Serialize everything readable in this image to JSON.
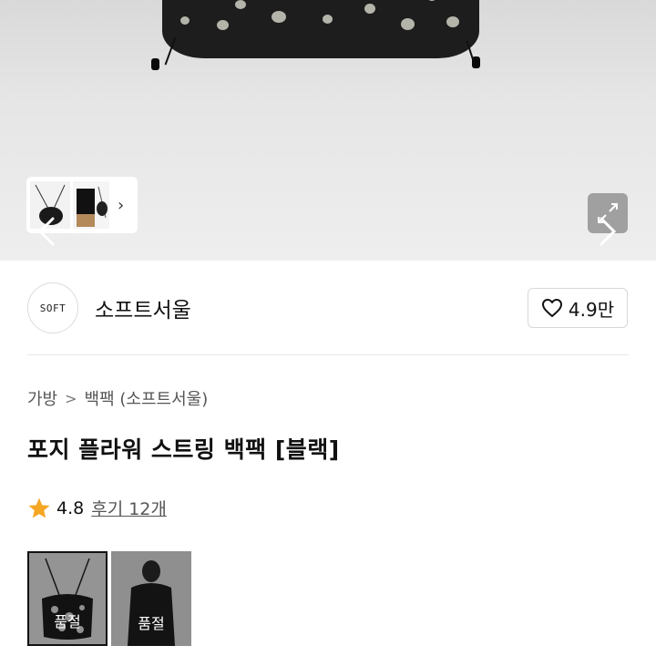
{
  "hero": {
    "thumbnail_strip_chevron": "›",
    "nav_prev_icon": "chevron-left-icon",
    "nav_next_icon": "chevron-right-icon",
    "expand_icon": "expand-icon"
  },
  "brand": {
    "logo_text": "SOFT",
    "name": "소프트서울",
    "like_icon": "heart-icon",
    "like_count": "4.9만"
  },
  "breadcrumb": {
    "category": "가방",
    "separator": ">",
    "subcategory": "백팩 (소프트서울)"
  },
  "product": {
    "title": "포지 플라워 스트링 백팩 [블랙]"
  },
  "rating": {
    "star_icon": "star-icon",
    "star_color": "#f5a623",
    "value": "4.8",
    "reviews": "후기 12개"
  },
  "options": [
    {
      "status": "품절",
      "selected": true
    },
    {
      "status": "품절",
      "selected": false
    }
  ],
  "colors": {
    "text_primary": "#111111",
    "text_secondary": "#555555",
    "border": "#d8d8d8"
  }
}
